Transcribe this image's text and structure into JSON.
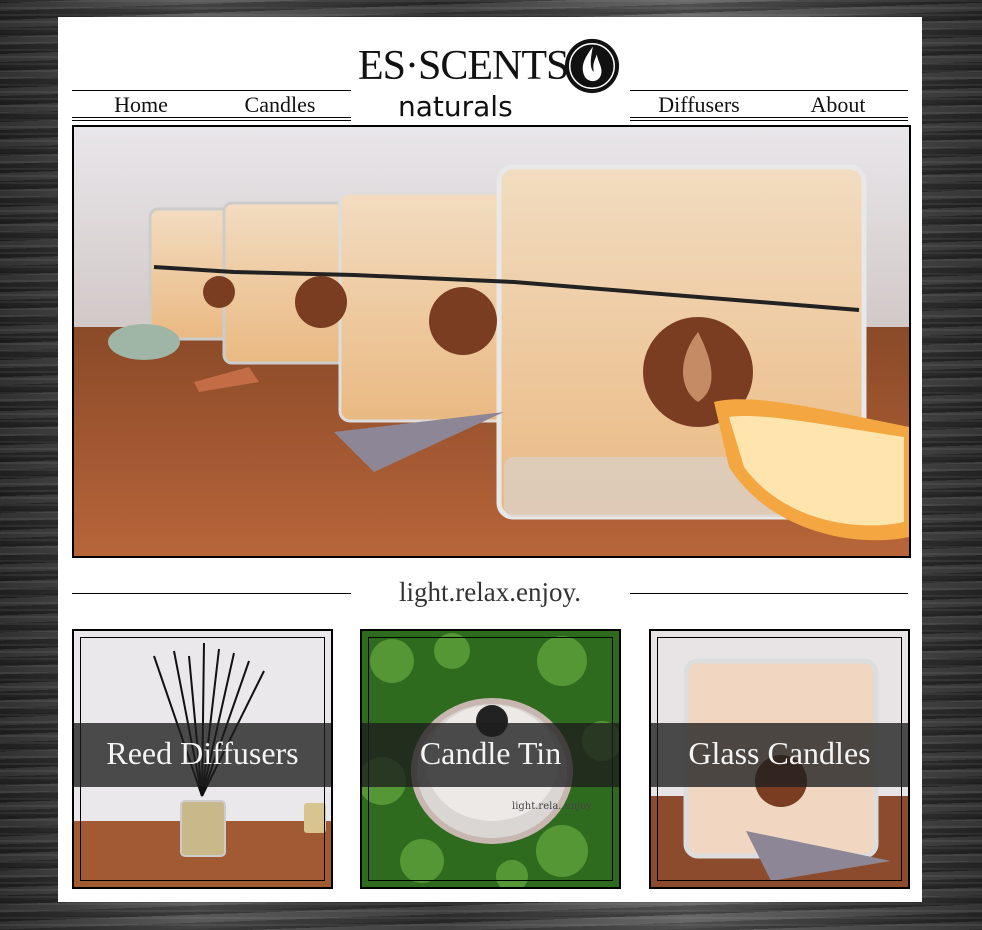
{
  "brand": {
    "name_top": "ES·SCENTS",
    "name_bottom": "naturals",
    "logo_icon": "flame-icon"
  },
  "nav": {
    "items": [
      {
        "label": "Home"
      },
      {
        "label": "Candles"
      },
      {
        "label": "Diffusers"
      },
      {
        "label": "About"
      }
    ]
  },
  "tagline": "light.relax.enjoy.",
  "tiles": [
    {
      "label": "Reed Diffusers"
    },
    {
      "label": "Candle Tin"
    },
    {
      "label": "Glass Candles"
    }
  ],
  "colors": {
    "page_bg": "#ffffff",
    "ink": "#111111",
    "band": "#1e1e1e"
  }
}
